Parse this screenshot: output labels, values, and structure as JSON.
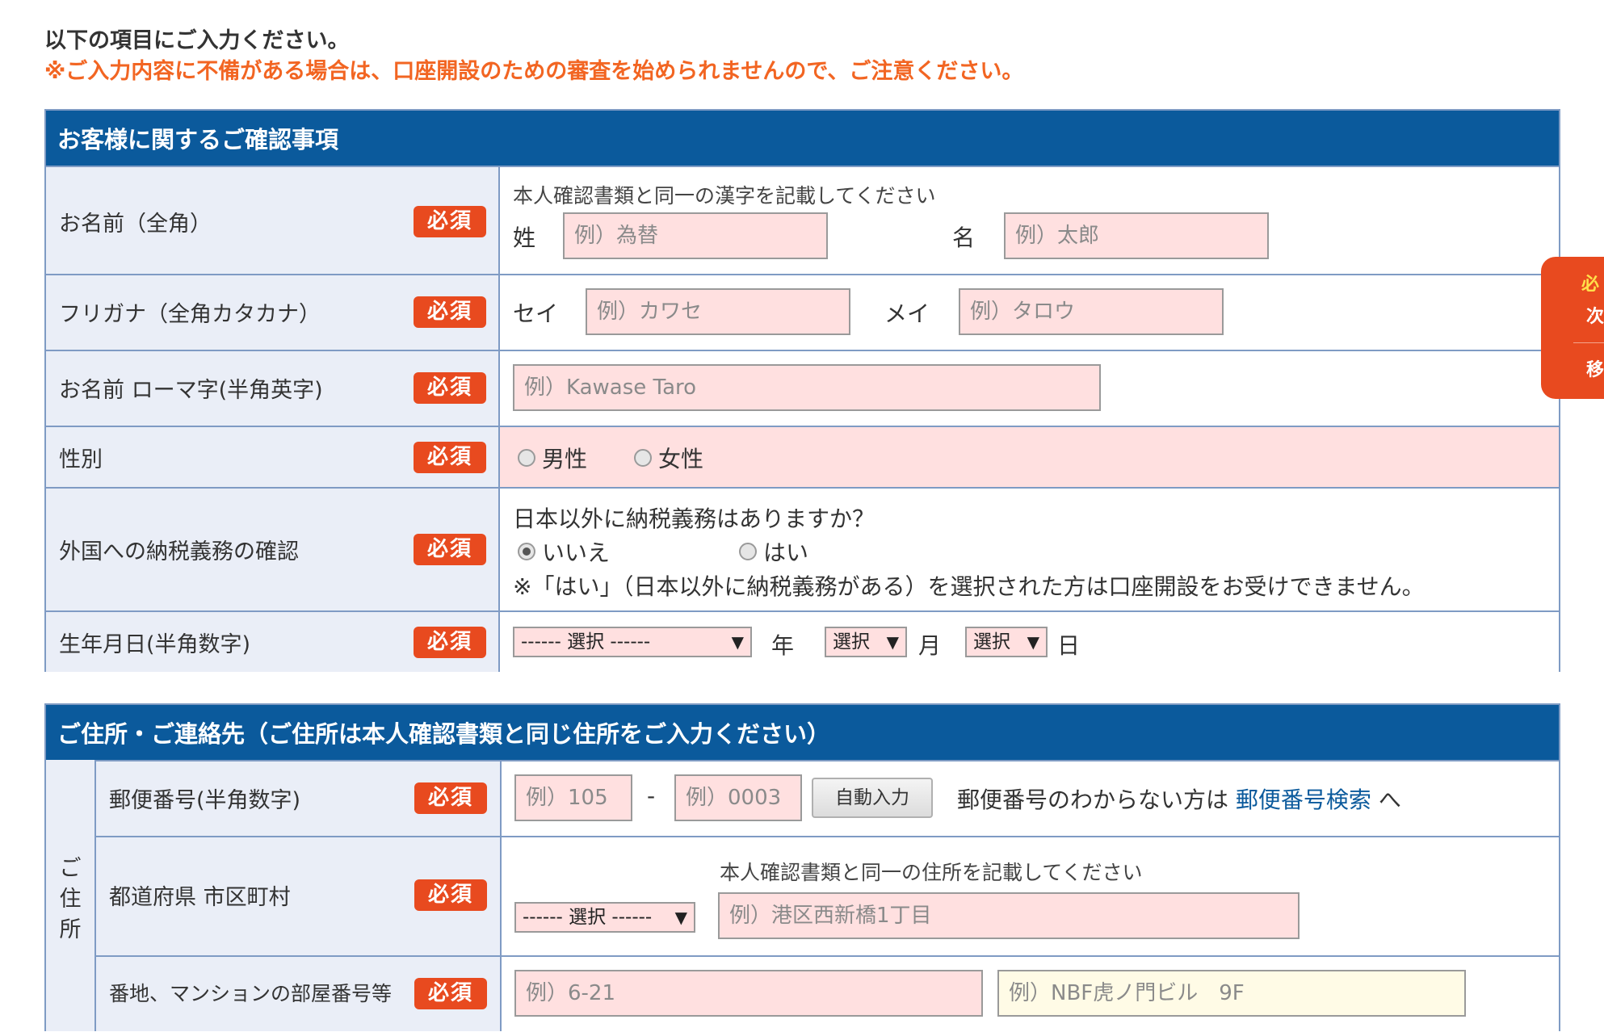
{
  "intro": {
    "line1": "以下の項目にご入力ください。",
    "line2": "※ご入力内容に不備がある場合は、口座開設のための審査を始められませんので、ご注意ください。"
  },
  "required_badge": "必須",
  "section1": {
    "title": "お客様に関するご確認事項",
    "name": {
      "label": "お名前（全角）",
      "note": "本人確認書類と同一の漢字を記載してください",
      "sei_label": "姓",
      "sei_placeholder": "例）為替",
      "mei_label": "名",
      "mei_placeholder": "例）太郎"
    },
    "kana": {
      "label": "フリガナ（全角カタカナ）",
      "sei_label": "セイ",
      "sei_placeholder": "例）カワセ",
      "mei_label": "メイ",
      "mei_placeholder": "例）タロウ"
    },
    "roman": {
      "label": "お名前 ローマ字(半角英字)",
      "placeholder": "例）Kawase Taro"
    },
    "gender": {
      "label": "性別",
      "option_male": "男性",
      "option_female": "女性"
    },
    "tax": {
      "label": "外国への納税義務の確認",
      "question": "日本以外に納税義務はありますか？",
      "option_no": "いいえ",
      "option_yes": "はい",
      "selected": "いいえ",
      "note": "※「はい」（日本以外に納税義務がある）を選択された方は口座開設をお受けできません。"
    },
    "birth": {
      "label": "生年月日(半角数字)",
      "year_select": "------ 選択 ------",
      "year_unit": "年",
      "month_select": "選択",
      "month_unit": "月",
      "day_select": "選択",
      "day_unit": "日"
    }
  },
  "section2": {
    "title": "ご住所・ご連絡先（ご住所は本人確認書類と同じ住所をご入力ください）",
    "side_label": [
      "ご",
      "住",
      "所"
    ],
    "postal": {
      "label": "郵便番号(半角数字)",
      "placeholder1": "例）105",
      "dash": "-",
      "placeholder2": "例）0003",
      "auto_button": "自動入力",
      "help_text": "郵便番号のわからない方は",
      "help_link": "郵便番号検索",
      "help_suffix": "へ"
    },
    "prefecture": {
      "label": "都道府県 市区町村",
      "note": "本人確認書類と同一の住所を記載してください",
      "select": "------ 選択 ------",
      "city_placeholder": "例）港区西新橋1丁目"
    },
    "address": {
      "label": "番地、マンションの部屋番号等",
      "placeholder1": "例）6-21",
      "placeholder2": "例）NBF虎ノ門ビル　9F"
    }
  },
  "float_tab": {
    "line1": "必",
    "line2": "次",
    "line3": "移"
  },
  "colors": {
    "header_bg": "#0b5a9c",
    "badge_bg": "#e84a1f",
    "warning_text": "#f26522",
    "input_bg": "#ffe0e0",
    "label_bg": "#eaeef7"
  }
}
